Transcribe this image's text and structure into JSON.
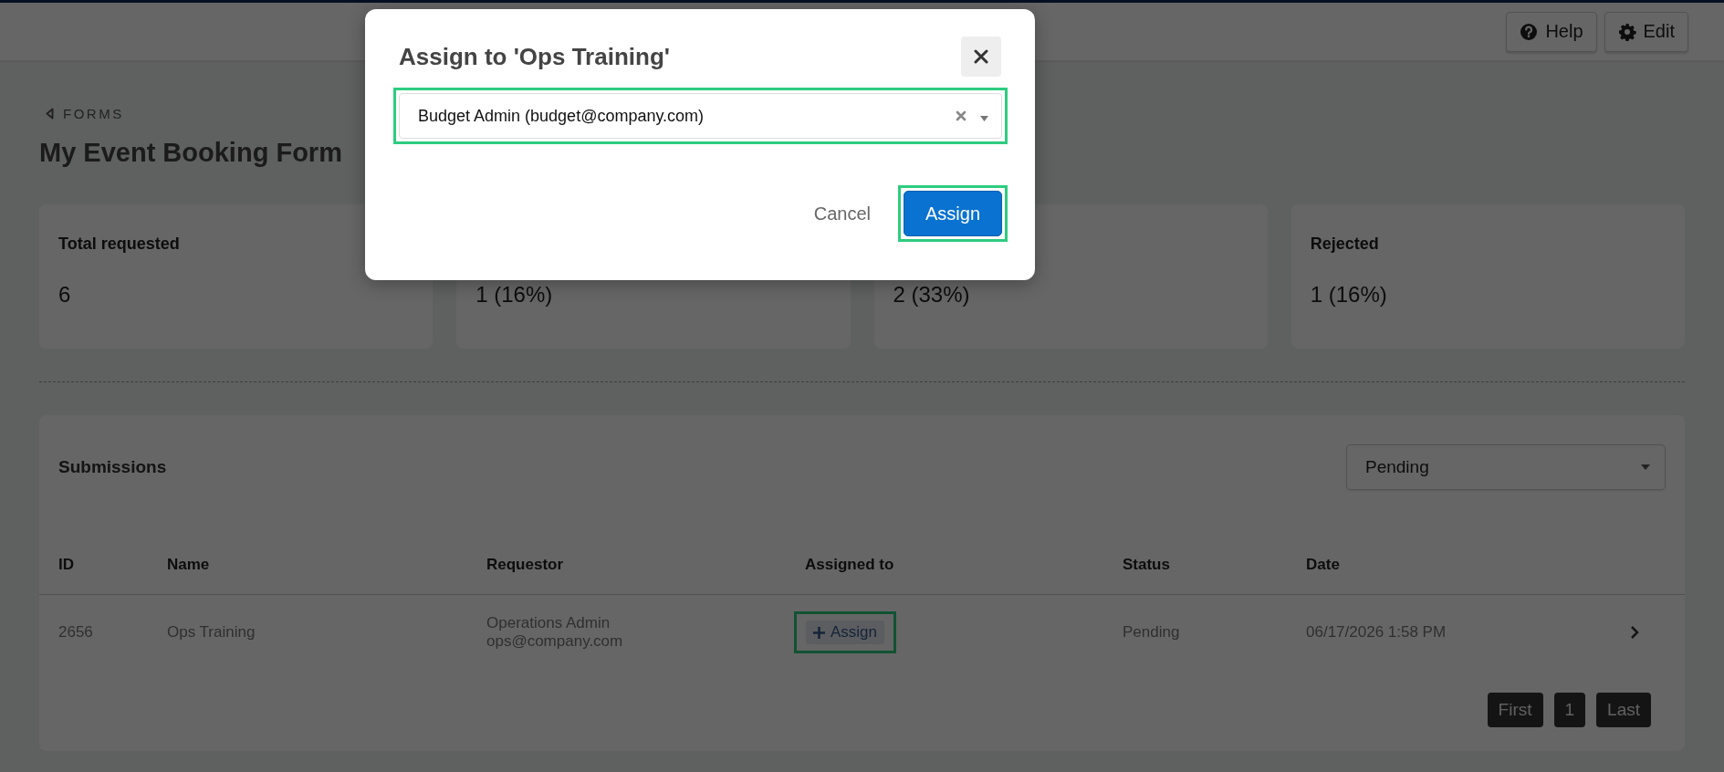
{
  "header": {
    "buttons": [
      {
        "label": "Help"
      },
      {
        "label": "Edit"
      }
    ]
  },
  "breadcrumb": "FORMS",
  "title": "My Event Booking Form",
  "stats": [
    {
      "label": "Total requested",
      "value": "6"
    },
    {
      "value": "1 (16%)"
    },
    {
      "value": "2 (33%)"
    },
    {
      "label": "Rejected",
      "value": "1 (16%)"
    }
  ],
  "submissions": {
    "title": "Submissions",
    "filter": "Pending",
    "columns": [
      "ID",
      "Name",
      "Requestor",
      "Assigned to",
      "Status",
      "Date"
    ],
    "rows": [
      {
        "id": "2656",
        "name": "Ops Training",
        "requestor_name": "Operations Admin",
        "requestor_email": "ops@company.com",
        "assign_label": "Assign",
        "assign_highlighted": true,
        "status": "Pending",
        "date": "06/17/2026 1:58 PM"
      }
    ],
    "pagination": [
      "First",
      "1",
      "Last"
    ]
  },
  "modal": {
    "title": "Assign to 'Ops Training'",
    "select": {
      "value": "Budget Admin (budget@company.com)",
      "highlighted": true
    },
    "buttons": [
      {
        "kind": "link",
        "label": "Cancel",
        "highlighted": false
      },
      {
        "kind": "primary",
        "label": "Assign",
        "highlighted": true
      }
    ]
  }
}
